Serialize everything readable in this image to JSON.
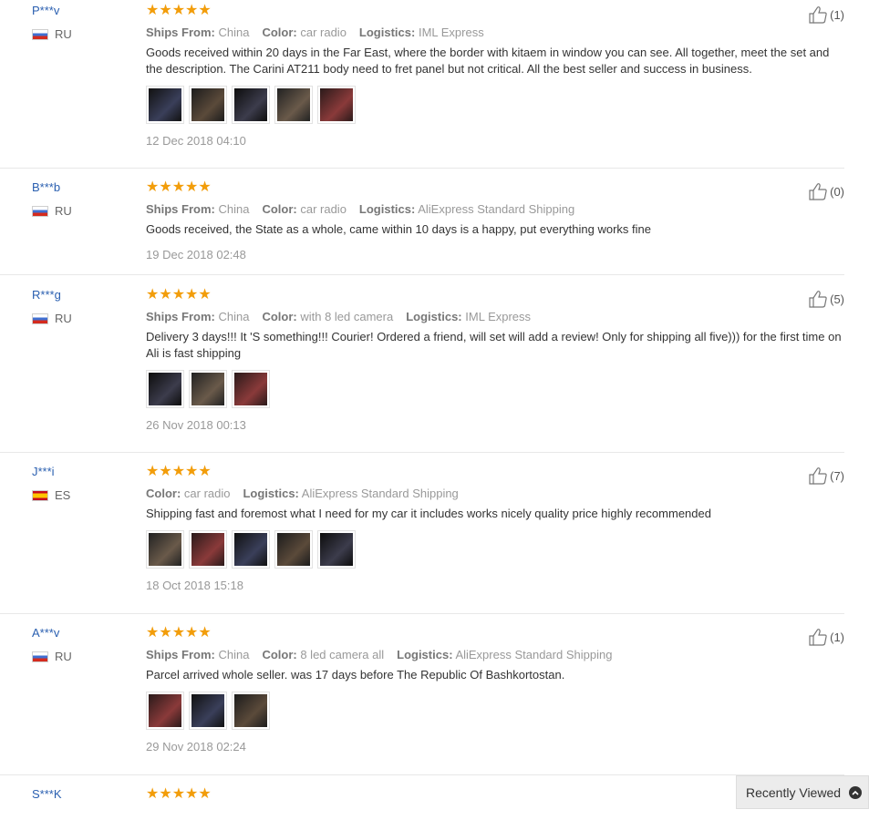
{
  "labels": {
    "ships_from": "Ships From:",
    "color": "Color:",
    "logistics": "Logistics:"
  },
  "stars": "★★★★★",
  "reviews": [
    {
      "user": "P***v",
      "country": "RU",
      "flag": "ru",
      "ships_from": "China",
      "color": "car radio",
      "logistics": "IML Express",
      "text": "Goods received within 20 days in the Far East, where the border with kitaem in window you can see. All together, meet the set and the description. The Carini AT211 body need to fret panel but not critical. All the best seller and success in business.",
      "date": "12 Dec 2018 04:10",
      "helpful": "(1)",
      "photos": 5
    },
    {
      "user": "B***b",
      "country": "RU",
      "flag": "ru",
      "ships_from": "China",
      "color": "car radio",
      "logistics": "AliExpress Standard Shipping",
      "text": "Goods received, the State as a whole, came within 10 days is a happy, put everything works fine",
      "date": "19 Dec 2018 02:48",
      "helpful": "(0)",
      "photos": 0
    },
    {
      "user": "R***g",
      "country": "RU",
      "flag": "ru",
      "ships_from": "China",
      "color": "with 8 led camera",
      "logistics": "IML Express",
      "text": "Delivery 3 days!!! It 'S something!!! Courier! Ordered a friend, will set will add a review! Only for shipping all five))) for the first time on Ali is fast shipping",
      "date": "26 Nov 2018 00:13",
      "helpful": "(5)",
      "photos": 3
    },
    {
      "user": "J***i",
      "country": "ES",
      "flag": "es",
      "ships_from": null,
      "color": "car radio",
      "logistics": "AliExpress Standard Shipping",
      "text": "Shipping fast and foremost what I need for my car it includes works nicely quality price highly recommended",
      "date": "18 Oct 2018 15:18",
      "helpful": "(7)",
      "photos": 5
    },
    {
      "user": "A***v",
      "country": "RU",
      "flag": "ru",
      "ships_from": "China",
      "color": "8 led camera all",
      "logistics": "AliExpress Standard Shipping",
      "text": "Parcel arrived whole seller. was 17 days before The Republic Of Bashkortostan.",
      "date": "29 Nov 2018 02:24",
      "helpful": "(1)",
      "photos": 3
    },
    {
      "user": "S***K",
      "country": "",
      "flag": "",
      "ships_from": null,
      "color": null,
      "logistics": null,
      "text": "",
      "date": "",
      "helpful": "",
      "photos": 0
    }
  ],
  "recently_viewed": {
    "label": "Recently Viewed",
    "icon": "chevron-up-icon"
  },
  "colors": {
    "star": "#f29d0a",
    "username": "#2a5fb0",
    "meta": "#999999"
  }
}
